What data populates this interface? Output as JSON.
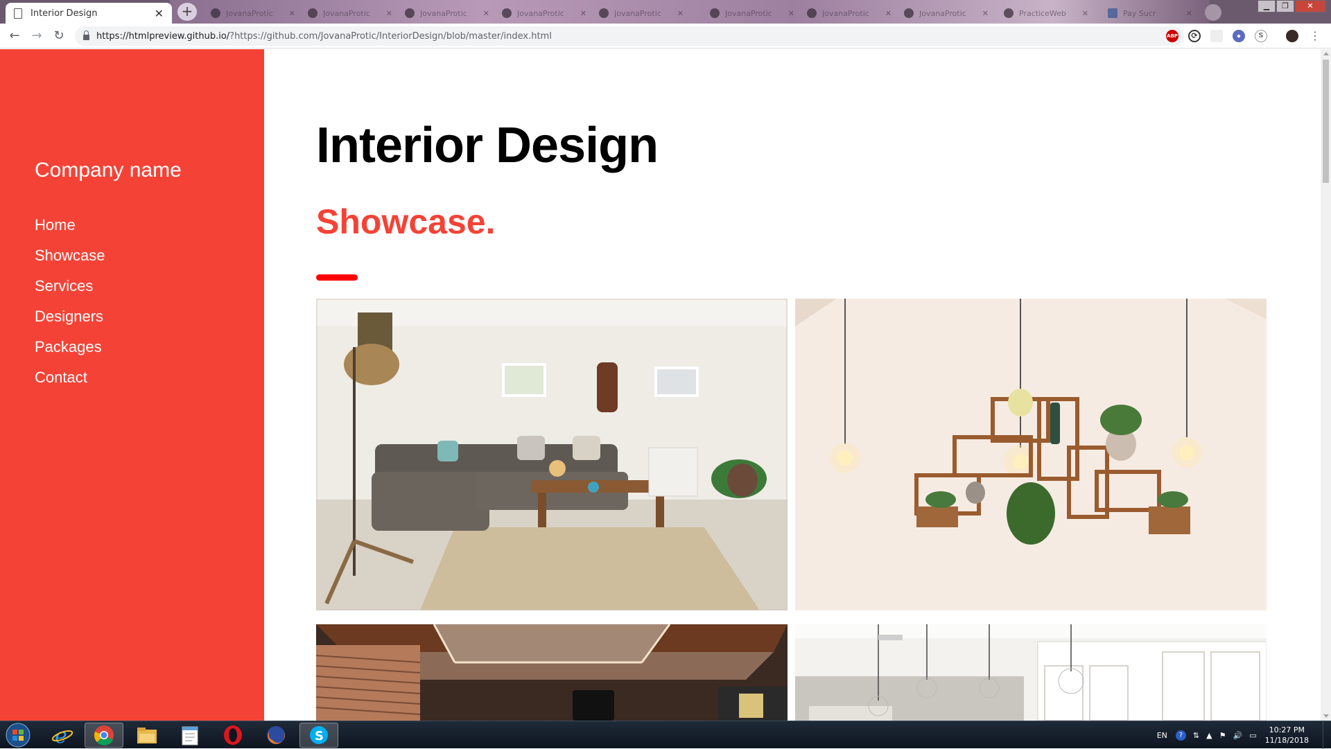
{
  "browser": {
    "active_tab_title": "Interior Design",
    "background_tabs": [
      "JovanaProtic",
      "JovanaProtic",
      "JovanaProtic",
      "JovanaProtic",
      "JovanaProtic",
      "JovanaProtic",
      "JovanaProtic",
      "JovanaProtic",
      "PracticeWeb",
      "Pay Sucr"
    ],
    "url_host": "https://htmlpreview.github.io/",
    "url_rest": "?https://github.com/JovanaProtic/InteriorDesign/blob/master/index.html",
    "extensions": [
      "ABP",
      "sync",
      "blank",
      "shield",
      "skype",
      "avatar"
    ]
  },
  "sidebar": {
    "company_name": "Company name",
    "nav": [
      "Home",
      "Showcase",
      "Services",
      "Designers",
      "Packages",
      "Contact"
    ],
    "background_color": "#f44336"
  },
  "main": {
    "title": "Interior Design",
    "section_title": "Showcase.",
    "accent_color": "#f44336"
  },
  "taskbar": {
    "apps": [
      "start-orb",
      "internet-explorer",
      "chrome",
      "file-explorer",
      "notepad",
      "opera",
      "firefox",
      "skype"
    ],
    "language": "EN",
    "time": "10:27 PM",
    "date": "11/18/2018"
  }
}
